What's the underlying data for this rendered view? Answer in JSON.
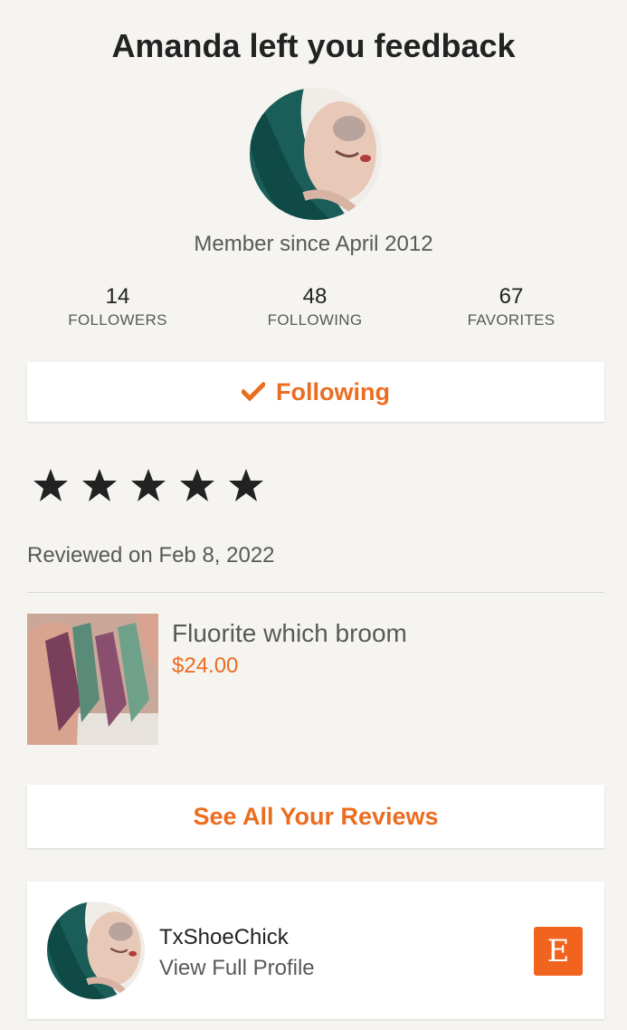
{
  "header": {
    "title": "Amanda left you feedback"
  },
  "profile": {
    "avatar_icon": "user-avatar-photo",
    "member_since": "Member since April 2012",
    "stats": [
      {
        "value": "14",
        "label": "FOLLOWERS"
      },
      {
        "value": "48",
        "label": "FOLLOWING"
      },
      {
        "value": "67",
        "label": "FAVORITES"
      }
    ]
  },
  "follow_button": {
    "label": "Following",
    "icon": "checkmark-icon"
  },
  "review": {
    "rating": 5,
    "max_rating": 5,
    "reviewed_on": "Reviewed on Feb 8, 2022",
    "item": {
      "title": "Fluorite which broom",
      "price": "$24.00",
      "thumbnail_icon": "product-photo"
    }
  },
  "see_all_button": {
    "label": "See All Your Reviews"
  },
  "profile_card": {
    "name": "TxShoeChick",
    "link_label": "View Full Profile",
    "logo_letter": "E"
  },
  "colors": {
    "accent": "#eb6d20",
    "etsy_orange": "#f1641e",
    "background": "#f5f4f1"
  }
}
